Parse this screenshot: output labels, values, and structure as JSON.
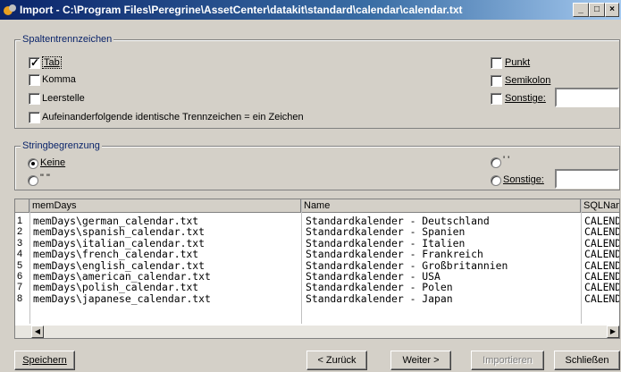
{
  "window": {
    "title": "Import - C:\\Program Files\\Peregrine\\AssetCenter\\datakit\\standard\\calendar\\calendar.txt",
    "minimize_glyph": "_",
    "maximize_glyph": "□",
    "close_glyph": "×"
  },
  "separators": {
    "legend": "Spaltentrennzeichen",
    "tab": {
      "label": "Tab",
      "checked": true
    },
    "comma": {
      "label": "Komma",
      "checked": false
    },
    "space": {
      "label": "Leerstelle",
      "checked": false
    },
    "consecutive": {
      "label": "Aufeinanderfolgende identische Trennzeichen = ein Zeichen",
      "checked": false
    },
    "point": {
      "label": "Punkt",
      "checked": false
    },
    "semicolon": {
      "label": "Semikolon",
      "checked": false
    },
    "other": {
      "label": "Sonstige:",
      "checked": false,
      "value": ""
    }
  },
  "string_delim": {
    "legend": "Stringbegrenzung",
    "none": {
      "label": "Keine",
      "selected": true
    },
    "double_quote": {
      "label": "\" \"",
      "selected": false
    },
    "single_quote": {
      "label": "' '",
      "selected": false
    },
    "other": {
      "label": "Sonstige:",
      "selected": false,
      "value": ""
    }
  },
  "preview": {
    "columns": [
      "memDays",
      "Name",
      "SQLName"
    ],
    "rows": [
      {
        "num": "1",
        "memDays": "memDays\\german_calendar.txt",
        "name": "Standardkalender - Deutschland",
        "sql": "CALEND"
      },
      {
        "num": "2",
        "memDays": "memDays\\spanish_calendar.txt",
        "name": "Standardkalender - Spanien",
        "sql": "CALEND"
      },
      {
        "num": "3",
        "memDays": "memDays\\italian_calendar.txt",
        "name": "Standardkalender - Italien",
        "sql": "CALEND"
      },
      {
        "num": "4",
        "memDays": "memDays\\french_calendar.txt",
        "name": "Standardkalender - Frankreich",
        "sql": "CALEND"
      },
      {
        "num": "5",
        "memDays": "memDays\\english_calendar.txt",
        "name": "Standardkalender - Großbritannien",
        "sql": "CALEND"
      },
      {
        "num": "6",
        "memDays": "memDays\\american_calendar.txt",
        "name": "Standardkalender - USA",
        "sql": "CALEND"
      },
      {
        "num": "7",
        "memDays": "memDays\\polish_calendar.txt",
        "name": "Standardkalender - Polen",
        "sql": "CALEND"
      },
      {
        "num": "8",
        "memDays": "memDays\\japanese_calendar.txt",
        "name": "Standardkalender - Japan",
        "sql": "CALEND"
      }
    ]
  },
  "buttons": {
    "save": "Speichern",
    "back": "< Zurück",
    "next": "Weiter >",
    "import": "Importieren",
    "close": "Schließen"
  }
}
